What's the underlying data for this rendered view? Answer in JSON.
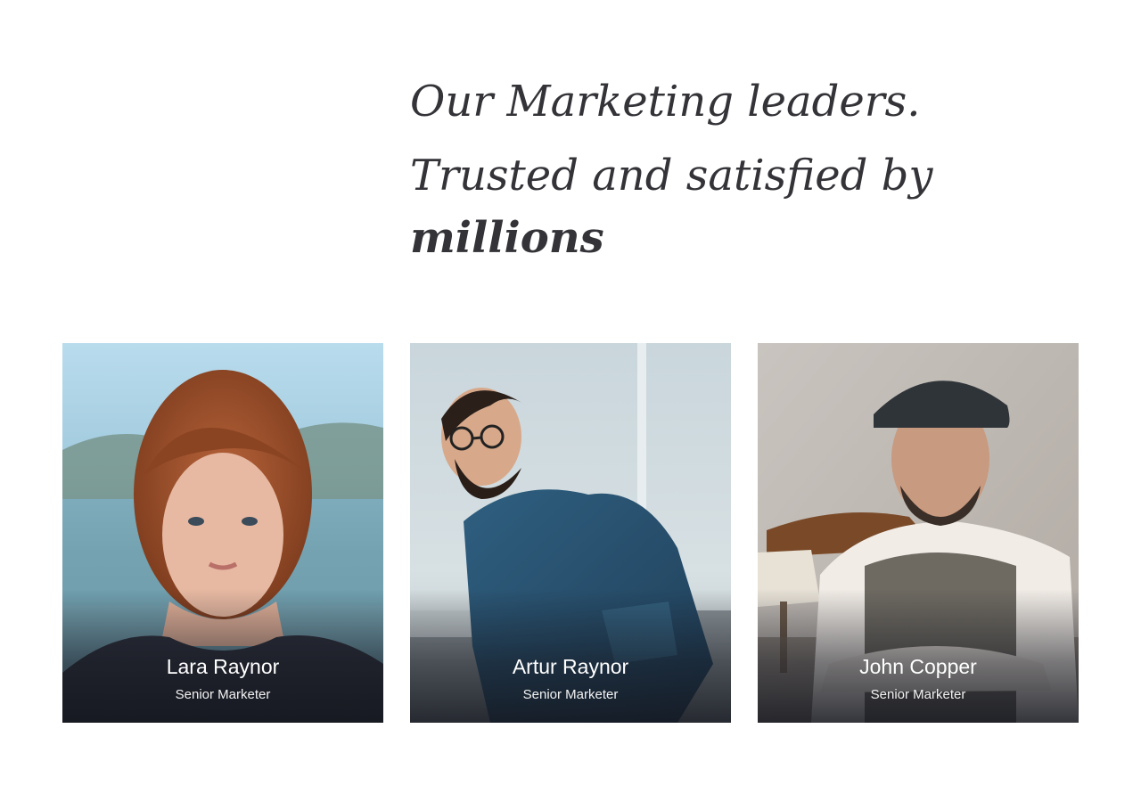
{
  "heading": {
    "line1": "Our Marketing leaders.",
    "line2_prefix": "Trusted and satisfied by",
    "line2_emphasis": "millions"
  },
  "team": [
    {
      "name": "Lara Raynor",
      "role": "Senior Marketer"
    },
    {
      "name": "Artur Raynor",
      "role": "Senior Marketer"
    },
    {
      "name": "John Copper",
      "role": "Senior Marketer"
    }
  ],
  "colors": {
    "heading_text": "#333338",
    "caption_text": "#ffffff",
    "background": "#ffffff"
  }
}
